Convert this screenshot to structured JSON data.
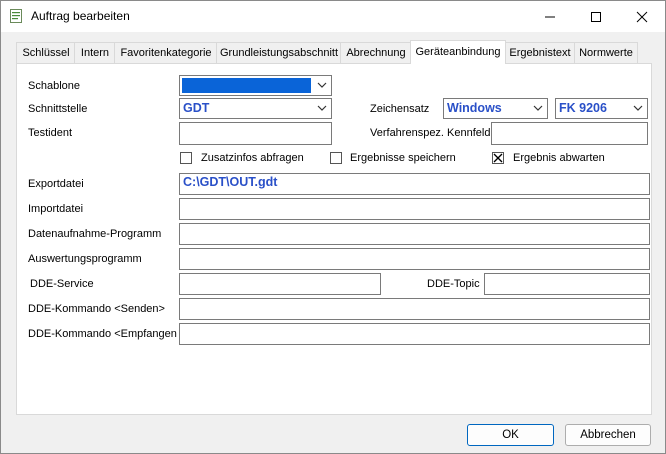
{
  "window": {
    "title": "Auftrag bearbeiten",
    "icon": "form-icon"
  },
  "tabs": [
    {
      "label": "Schlüssel"
    },
    {
      "label": "Intern"
    },
    {
      "label": "Favoritenkategorie"
    },
    {
      "label": "Grundleistungsabschnitt"
    },
    {
      "label": "Abrechnung"
    },
    {
      "label": "Geräteanbindung",
      "active": true
    },
    {
      "label": "Ergebnistext"
    },
    {
      "label": "Normwerte"
    }
  ],
  "form": {
    "schablone_label": "Schablone",
    "schablone_value": "",
    "schnittstelle_label": "Schnittstelle",
    "schnittstelle_value": "GDT",
    "zeichensatz_label": "Zeichensatz",
    "zeichensatz_value": "Windows",
    "fk_value": "FK 9206",
    "testident_label": "Testident",
    "testident_value": "",
    "kennfeld_label": "Verfahrenspez. Kennfeld",
    "kennfeld_value": "",
    "zusatzinfos_label": "Zusatzinfos abfragen",
    "zusatzinfos_checked": false,
    "ergebnisse_speichern_label": "Ergebnisse speichern",
    "ergebnisse_speichern_checked": false,
    "ergebnis_abwarten_label": "Ergebnis abwarten",
    "ergebnis_abwarten_checked": true,
    "exportdatei_label": "Exportdatei",
    "exportdatei_value": "C:\\GDT\\OUT.gdt",
    "importdatei_label": "Importdatei",
    "importdatei_value": "",
    "datenaufnahme_label": "Datenaufnahme-Programm",
    "datenaufnahme_value": "",
    "auswertung_label": "Auswertungsprogramm",
    "auswertung_value": "",
    "dde_service_label": "DDE-Service",
    "dde_service_value": "",
    "dde_topic_label": "DDE-Topic",
    "dde_topic_value": "",
    "dde_senden_label": "DDE-Kommando <Senden>",
    "dde_senden_value": "",
    "dde_empfangen_label": "DDE-Kommando <Empfangen",
    "dde_empfangen_value": ""
  },
  "buttons": {
    "ok_label": "OK",
    "cancel_label": "Abbrechen"
  },
  "colors": {
    "value_text": "#2a50c8",
    "selection": "#0a64d8"
  }
}
